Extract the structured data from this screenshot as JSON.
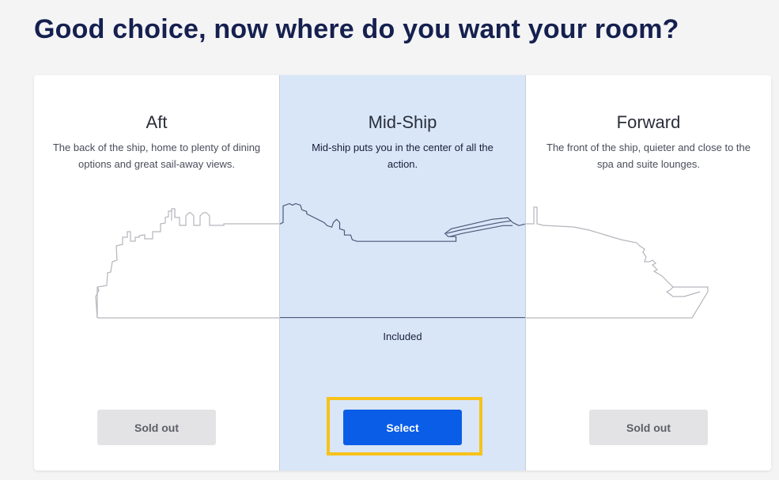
{
  "page": {
    "heading": "Good choice, now where do you want your room?"
  },
  "options": [
    {
      "title": "Aft",
      "description": "The back of the ship, home to plenty of dining options and great sail-away views.",
      "button_label": "Sold out",
      "status": ""
    },
    {
      "title": "Mid-Ship",
      "description": "Mid-ship puts you in the center of all the action.",
      "button_label": "Select",
      "status": "Included"
    },
    {
      "title": "Forward",
      "description": "The front of the ship, quieter and close to the spa and suite lounges.",
      "button_label": "Sold out",
      "status": ""
    }
  ],
  "colors": {
    "selected_column_bg": "#d8e6f8",
    "select_button": "#0a5de6",
    "highlight_border": "#f8c21b",
    "soldout_button": "#e3e3e5"
  }
}
